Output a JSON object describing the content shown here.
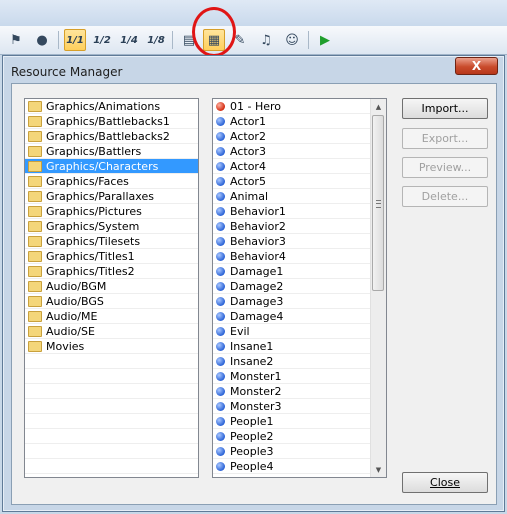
{
  "toolbar": {
    "buttons": [
      {
        "name": "map-mode-icon",
        "glyph": "⚑"
      },
      {
        "name": "event-mode-icon",
        "glyph": "●"
      },
      {
        "name": "zoom-1-1-icon",
        "glyph": "1/1"
      },
      {
        "name": "zoom-1-2-icon",
        "glyph": "1/2"
      },
      {
        "name": "zoom-1-4-icon",
        "glyph": "1/4"
      },
      {
        "name": "zoom-1-8-icon",
        "glyph": "1/8"
      },
      {
        "name": "database-icon",
        "glyph": "▤"
      },
      {
        "name": "resource-manager-icon",
        "glyph": "▦"
      },
      {
        "name": "script-editor-icon",
        "glyph": "✎"
      },
      {
        "name": "sound-test-icon",
        "glyph": "♫"
      },
      {
        "name": "character-generator-icon",
        "glyph": "☺"
      },
      {
        "name": "playtest-icon",
        "glyph": "▶"
      }
    ]
  },
  "dialog": {
    "title": "Resource Manager",
    "close_glyph": "X",
    "folders": [
      "Graphics/Animations",
      "Graphics/Battlebacks1",
      "Graphics/Battlebacks2",
      "Graphics/Battlers",
      "Graphics/Characters",
      "Graphics/Faces",
      "Graphics/Parallaxes",
      "Graphics/Pictures",
      "Graphics/System",
      "Graphics/Tilesets",
      "Graphics/Titles1",
      "Graphics/Titles2",
      "Audio/BGM",
      "Audio/BGS",
      "Audio/ME",
      "Audio/SE",
      "Movies"
    ],
    "selected_folder": "Graphics/Characters",
    "resources": [
      "01 - Hero",
      "Actor1",
      "Actor2",
      "Actor3",
      "Actor4",
      "Actor5",
      "Animal",
      "Behavior1",
      "Behavior2",
      "Behavior3",
      "Behavior4",
      "Damage1",
      "Damage2",
      "Damage3",
      "Damage4",
      "Evil",
      "Insane1",
      "Insane2",
      "Monster1",
      "Monster2",
      "Monster3",
      "People1",
      "People2",
      "People3",
      "People4"
    ],
    "imported_resource": "01 - Hero",
    "buttons": {
      "import": "Import...",
      "export": "Export...",
      "preview": "Preview...",
      "delete": "Delete...",
      "close": "Close"
    }
  }
}
